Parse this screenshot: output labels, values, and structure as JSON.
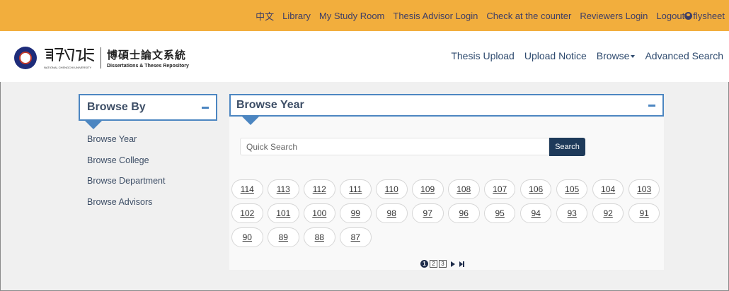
{
  "topnav": {
    "items": [
      "中文",
      "Library",
      "My Study Room",
      "Thesis Advisor Login",
      "Check at the counter",
      "Reviewers Login"
    ],
    "logout": "Logout",
    "username": "flysheet"
  },
  "header": {
    "logo_cn": "博碩士論文系統",
    "logo_en": "Dissertations & Theses Repository",
    "university_en": "NATIONAL CHENGCHI UNIVERSITY",
    "nav": [
      "Thesis Upload",
      "Upload Notice",
      "Browse",
      "Advanced Search"
    ]
  },
  "browse_by": {
    "title": "Browse By",
    "links": [
      "Browse Year",
      "Browse College",
      "Browse Department",
      "Browse Advisors"
    ]
  },
  "browse_year": {
    "title": "Browse Year",
    "search_placeholder": "Quick Search",
    "search_button": "Search",
    "years": [
      "114",
      "113",
      "112",
      "111",
      "110",
      "109",
      "108",
      "107",
      "106",
      "105",
      "104",
      "103",
      "102",
      "101",
      "100",
      "99",
      "98",
      "97",
      "96",
      "95",
      "94",
      "93",
      "92",
      "91",
      "90",
      "89",
      "88",
      "87"
    ],
    "pages": [
      "1",
      "2",
      "3"
    ],
    "current_page": "1"
  },
  "colors": {
    "topbar": "#f2ae3d",
    "accent": "#4c86c1",
    "button": "#1e3a5a"
  }
}
